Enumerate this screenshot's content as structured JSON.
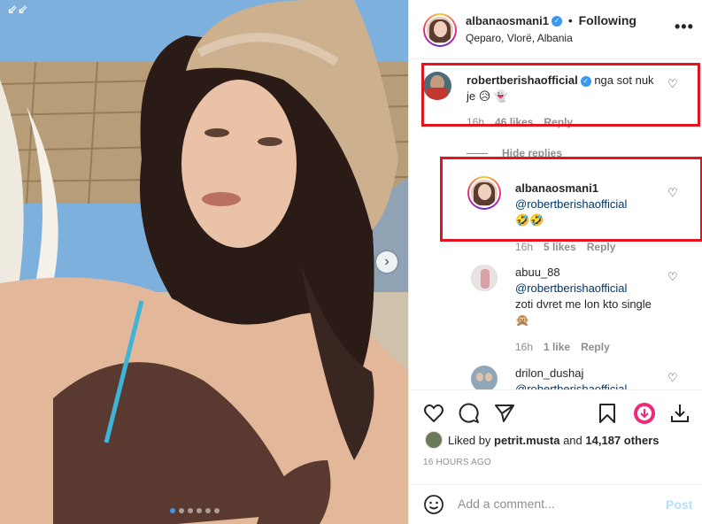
{
  "post": {
    "author": "albanaosmani1",
    "separator": "•",
    "follow_status": "Following",
    "location": "Qeparo, Vlorë, Albania",
    "verified_mark": "✓"
  },
  "comments": [
    {
      "username": "robertberishaofficial",
      "text": "nga sot nuk je 😥 👻",
      "meta": {
        "time": "16h",
        "likes": "46 likes",
        "reply": "Reply"
      }
    }
  ],
  "hide_replies_label": "Hide replies",
  "replies": [
    {
      "username": "albanaosmani1",
      "mention": "@robertberishaofficial",
      "text": "🤣🤣",
      "meta": {
        "time": "16h",
        "likes": "5 likes",
        "reply": "Reply"
      }
    },
    {
      "username": "abuu_88",
      "mention": "@robertberishaofficial",
      "text": "zoti dvret me lon kto single 🙊",
      "meta": {
        "time": "16h",
        "likes": "1 like",
        "reply": "Reply"
      }
    },
    {
      "username": "drilon_dushaj",
      "mention": "@robertberishaofficial"
    }
  ],
  "likes": {
    "prefix": "Liked by",
    "user": "petrit.musta",
    "connector": "and",
    "others": "14,187 others"
  },
  "timestamp": "16 HOURS AGO",
  "add_comment": {
    "placeholder": "Add a comment...",
    "post_label": "Post"
  },
  "carousel": {
    "slide_count": 6,
    "active_index": 0
  },
  "colors": {
    "accent": "#3897f0",
    "highlight_box": "#e3141f",
    "reels_icon": "#ee2a7b"
  }
}
